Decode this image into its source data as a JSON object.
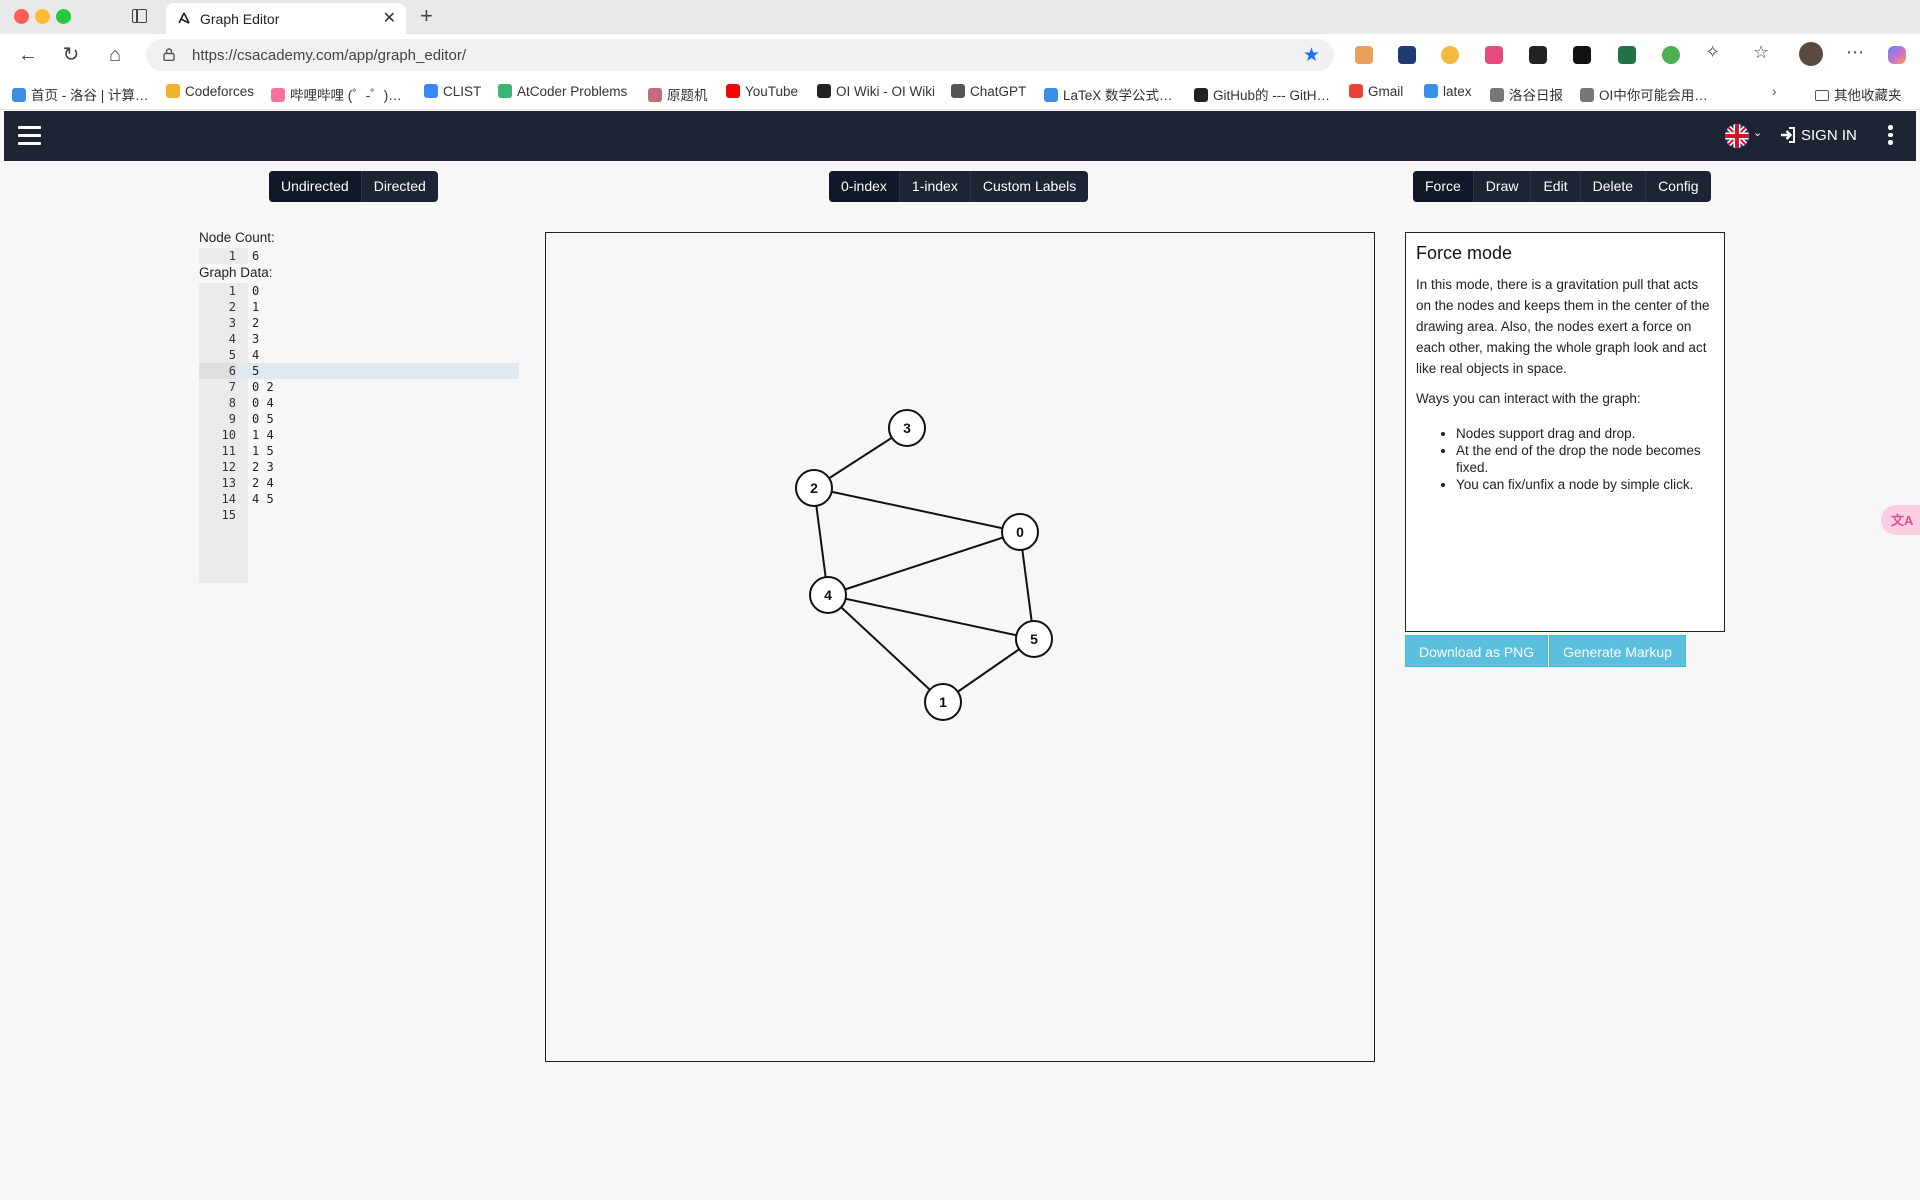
{
  "browser": {
    "tab_title": "Graph Editor",
    "url": "https://csacademy.com/app/graph_editor/",
    "bookmarks": [
      {
        "label": "首页 - 洛谷 | 计算…",
        "color": "#3c8fe6"
      },
      {
        "label": "Codeforces",
        "color": "#f0b030"
      },
      {
        "label": "哔哩哔哩 (゜-゜)…",
        "color": "#fb7299"
      },
      {
        "label": "CLIST",
        "color": "#3a86ff"
      },
      {
        "label": "AtCoder Problems",
        "color": "#3cb371"
      },
      {
        "label": "原题机",
        "color": "#c46a7a"
      },
      {
        "label": "YouTube",
        "color": "#ff0000"
      },
      {
        "label": "OI Wiki - OI Wiki",
        "color": "#222222"
      },
      {
        "label": "ChatGPT",
        "color": "#555555"
      },
      {
        "label": "LaTeX 数学公式…",
        "color": "#3c8fe6"
      },
      {
        "label": "GitHub的 --- GitH…",
        "color": "#222222"
      },
      {
        "label": "Gmail",
        "color": "#ea4335"
      },
      {
        "label": "latex",
        "color": "#3c8fe6"
      },
      {
        "label": "洛谷日报",
        "color": "#777777"
      },
      {
        "label": "OI中你可能会用…",
        "color": "#777777"
      }
    ],
    "other_bookmarks": "其他收藏夹"
  },
  "header": {
    "signin_label": "SIGN IN",
    "language_icon": "uk-flag-icon"
  },
  "toolbar": {
    "direction": [
      {
        "label": "Undirected",
        "active": true
      },
      {
        "label": "Directed",
        "active": false
      }
    ],
    "indexing": [
      {
        "label": "0-index",
        "active": true
      },
      {
        "label": "1-index",
        "active": false
      },
      {
        "label": "Custom Labels",
        "active": false
      }
    ],
    "modes": [
      {
        "label": "Force",
        "active": true
      },
      {
        "label": "Draw",
        "active": false
      },
      {
        "label": "Edit",
        "active": false
      },
      {
        "label": "Delete",
        "active": false
      },
      {
        "label": "Config",
        "active": false
      }
    ]
  },
  "editor": {
    "node_count_label": "Node Count:",
    "node_count_lines": [
      "6"
    ],
    "graph_data_label": "Graph Data:",
    "graph_data_lines": [
      "0",
      "1",
      "2",
      "3",
      "4",
      "5",
      "0 2",
      "0 4",
      "0 5",
      "1 4",
      "1 5",
      "2 3",
      "2 4",
      "4 5",
      ""
    ],
    "highlighted_line": 6
  },
  "graph": {
    "nodes": [
      "0",
      "1",
      "2",
      "3",
      "4",
      "5"
    ],
    "edges": [
      [
        "0",
        "2"
      ],
      [
        "0",
        "4"
      ],
      [
        "0",
        "5"
      ],
      [
        "1",
        "4"
      ],
      [
        "1",
        "5"
      ],
      [
        "2",
        "3"
      ],
      [
        "2",
        "4"
      ],
      [
        "4",
        "5"
      ]
    ]
  },
  "info": {
    "title": "Force mode",
    "paragraph": "In this mode, there is a gravitation pull that acts on the nodes and keeps them in the center of the drawing area. Also, the nodes exert a force on each other, making the whole graph look and act like real objects in space.",
    "ways_label": "Ways you can interact with the graph:",
    "bullets": [
      "Nodes support drag and drop.",
      "At the end of the drop the node becomes fixed.",
      "You can fix/unfix a node by simple click."
    ]
  },
  "actions": {
    "download_label": "Download as PNG",
    "markup_label": "Generate Markup"
  }
}
